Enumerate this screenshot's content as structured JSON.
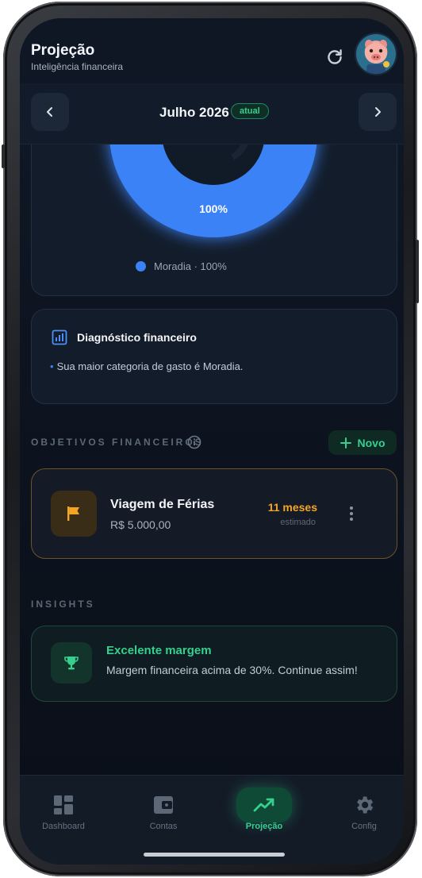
{
  "header": {
    "title": "Projeção",
    "subtitle": "Inteligência financeira"
  },
  "month_nav": {
    "label": "Julho 2026",
    "badge": "atual"
  },
  "chart_data": {
    "type": "pie",
    "categories": [
      "Moradia"
    ],
    "values": [
      100
    ],
    "data_labels": [
      "100%"
    ],
    "legend": [
      "Moradia · 100%"
    ],
    "colors": [
      "#3b82f6"
    ]
  },
  "diagnostico": {
    "title": "Diagnóstico financeiro",
    "bullet": "Sua maior categoria de gasto é Moradia."
  },
  "objetivos": {
    "section_label": "OBJETIVOS FINANCEIROS",
    "new_button": "Novo",
    "items": [
      {
        "name": "Viagem de Férias",
        "amount": "R$ 5.000,00",
        "time": "11 meses",
        "time_sub": "estimado",
        "accent": "#f5a524"
      }
    ]
  },
  "insights": {
    "section_label": "INSIGHTS",
    "items": [
      {
        "title": "Excelente margem",
        "text": "Margem financeira acima de 30%. Continue assim!",
        "accent": "#35d08e"
      }
    ]
  },
  "tabbar": {
    "items": [
      {
        "label": "Dashboard",
        "icon": "dashboard-icon",
        "active": false
      },
      {
        "label": "Contas",
        "icon": "wallet-icon",
        "active": false
      },
      {
        "label": "Projeção",
        "icon": "trending-up-icon",
        "active": true
      },
      {
        "label": "Config",
        "icon": "gear-icon",
        "active": false
      }
    ]
  },
  "colors": {
    "accent_green": "#35d08e",
    "accent_blue": "#3b82f6",
    "accent_orange": "#f5a524"
  }
}
